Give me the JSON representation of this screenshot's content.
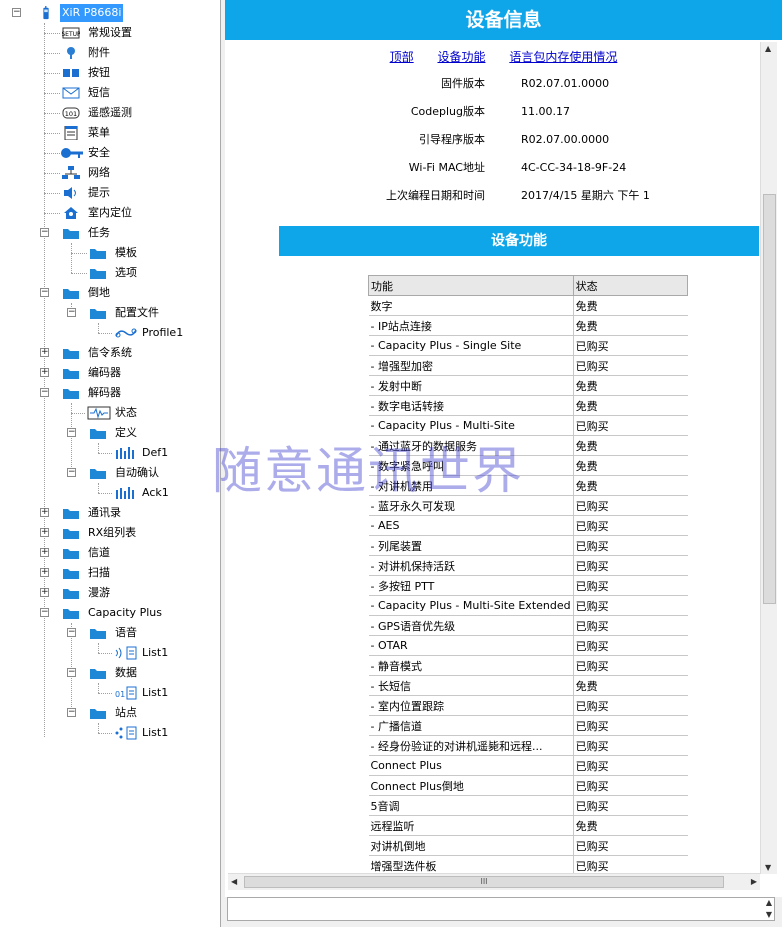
{
  "tree": {
    "root": "XiR P8668i",
    "items": {
      "general": "常规设置",
      "accessories": "附件",
      "buttons": "按钮",
      "text_message": "短信",
      "telemetry": "遥感遥测",
      "menu": "菜单",
      "security": "安全",
      "network": "网络",
      "alerts": "提示",
      "indoor": "室内定位",
      "tasks": "任务",
      "templates": "模板",
      "options": "选项",
      "talkaround": "倒地",
      "profiles": "配置文件",
      "profile1": "Profile1",
      "signaling": "信令系统",
      "encoder": "编码器",
      "decoder": "解码器",
      "status": "状态",
      "definition": "定义",
      "def1": "Def1",
      "auto_ack": "自动确认",
      "ack1": "Ack1",
      "contacts": "通讯录",
      "rx_group": "RX组列表",
      "channels": "信道",
      "scan": "扫描",
      "roam": "漫游",
      "capacity_plus": "Capacity Plus",
      "voice": "语音",
      "voice_list1": "List1",
      "data": "数据",
      "data_list1": "List1",
      "sites": "站点",
      "site_list1": "List1"
    }
  },
  "panel": {
    "title": "设备信息",
    "links": [
      "顶部",
      "设备功能",
      "语言包内存使用情况"
    ],
    "info": [
      {
        "key": "固件版本",
        "value": "R02.07.01.0000"
      },
      {
        "key": "Codeplug版本",
        "value": "11.00.17"
      },
      {
        "key": "引导程序版本",
        "value": "R02.07.00.0000"
      },
      {
        "key": "Wi-Fi MAC地址",
        "value": "4C-CC-34-18-9F-24"
      },
      {
        "key": "上次编程日期和时间",
        "value": "2017/4/15 星期六 下午 1"
      }
    ],
    "section_title": "设备功能",
    "table_headers": [
      "功能",
      "状态"
    ],
    "features": [
      [
        "数字",
        "免费"
      ],
      [
        "- IP站点连接",
        "免费"
      ],
      [
        "- Capacity Plus - Single Site",
        "已购买"
      ],
      [
        "- 增强型加密",
        "已购买"
      ],
      [
        "- 发射中断",
        "免费"
      ],
      [
        "- 数字电话转接",
        "免费"
      ],
      [
        "- Capacity Plus - Multi-Site",
        "已购买"
      ],
      [
        "- 通过蓝牙的数据服务",
        "免费"
      ],
      [
        "- 数字紧急呼叫",
        "免费"
      ],
      [
        "- 对讲机禁用",
        "免费"
      ],
      [
        "- 蓝牙永久可发现",
        "已购买"
      ],
      [
        "- AES",
        "已购买"
      ],
      [
        "- 列尾装置",
        "已购买"
      ],
      [
        "- 对讲机保持活跃",
        "已购买"
      ],
      [
        "- 多按钮 PTT",
        "已购买"
      ],
      [
        "- Capacity Plus - Multi-Site Extended",
        "已购买"
      ],
      [
        "- GPS语音优先级",
        "已购买"
      ],
      [
        "- OTAR",
        "已购买"
      ],
      [
        "- 静音模式",
        "已购买"
      ],
      [
        "- 长短信",
        "免费"
      ],
      [
        "- 室内位置跟踪",
        "已购买"
      ],
      [
        "- 广播信道",
        "已购买"
      ],
      [
        "- 经身份验证的对讲机遥毙和远程...",
        "已购买"
      ],
      [
        "Connect Plus",
        "已购买"
      ],
      [
        "Connect Plus倒地",
        "已购买"
      ],
      [
        "5音调",
        "已购买"
      ],
      [
        "远程监听",
        "免费"
      ],
      [
        "对讲机倒地",
        "已购买"
      ],
      [
        "增强型选件板",
        "已购买"
      ]
    ]
  },
  "scrollbar": {
    "h_thumb_grip": "III"
  },
  "watermark": "随意通讯世界",
  "colors": {
    "accent": "#0fa5e9",
    "link": "#0000cc",
    "selection": "#3399ff"
  }
}
